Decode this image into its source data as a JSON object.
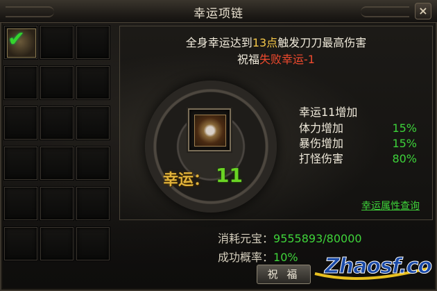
{
  "window": {
    "title": "幸运项链",
    "close_label": "×"
  },
  "description": {
    "line1_prefix": "全身幸运达到",
    "line1_highlight": "13点",
    "line1_suffix": "触发刀刀最高伤害",
    "line2_prefix": "祝福",
    "line2_red": "失败幸运-1"
  },
  "luck": {
    "label": "幸运：",
    "value": "11"
  },
  "stats": {
    "header": "幸运11增加",
    "rows": [
      {
        "name": "体力增加",
        "value": "15%"
      },
      {
        "name": "暴伤增加",
        "value": "15%"
      },
      {
        "name": "打怪伤害",
        "value": "80%"
      }
    ]
  },
  "query_link": "幸运属性查询",
  "cost": {
    "label": "消耗元宝：",
    "value": "9555893/80000"
  },
  "success_rate": {
    "label": "成功概率：",
    "value": "10%"
  },
  "bless_button": "祝 福",
  "watermark": "Zhaosf.co",
  "inventory": {
    "slot_count": 18,
    "equipped_slot": 0,
    "equipped_icon": "checkmark-icon"
  },
  "colors": {
    "green": "#3fd43a",
    "red": "#f04a2e",
    "gold": "#e0b23a"
  }
}
